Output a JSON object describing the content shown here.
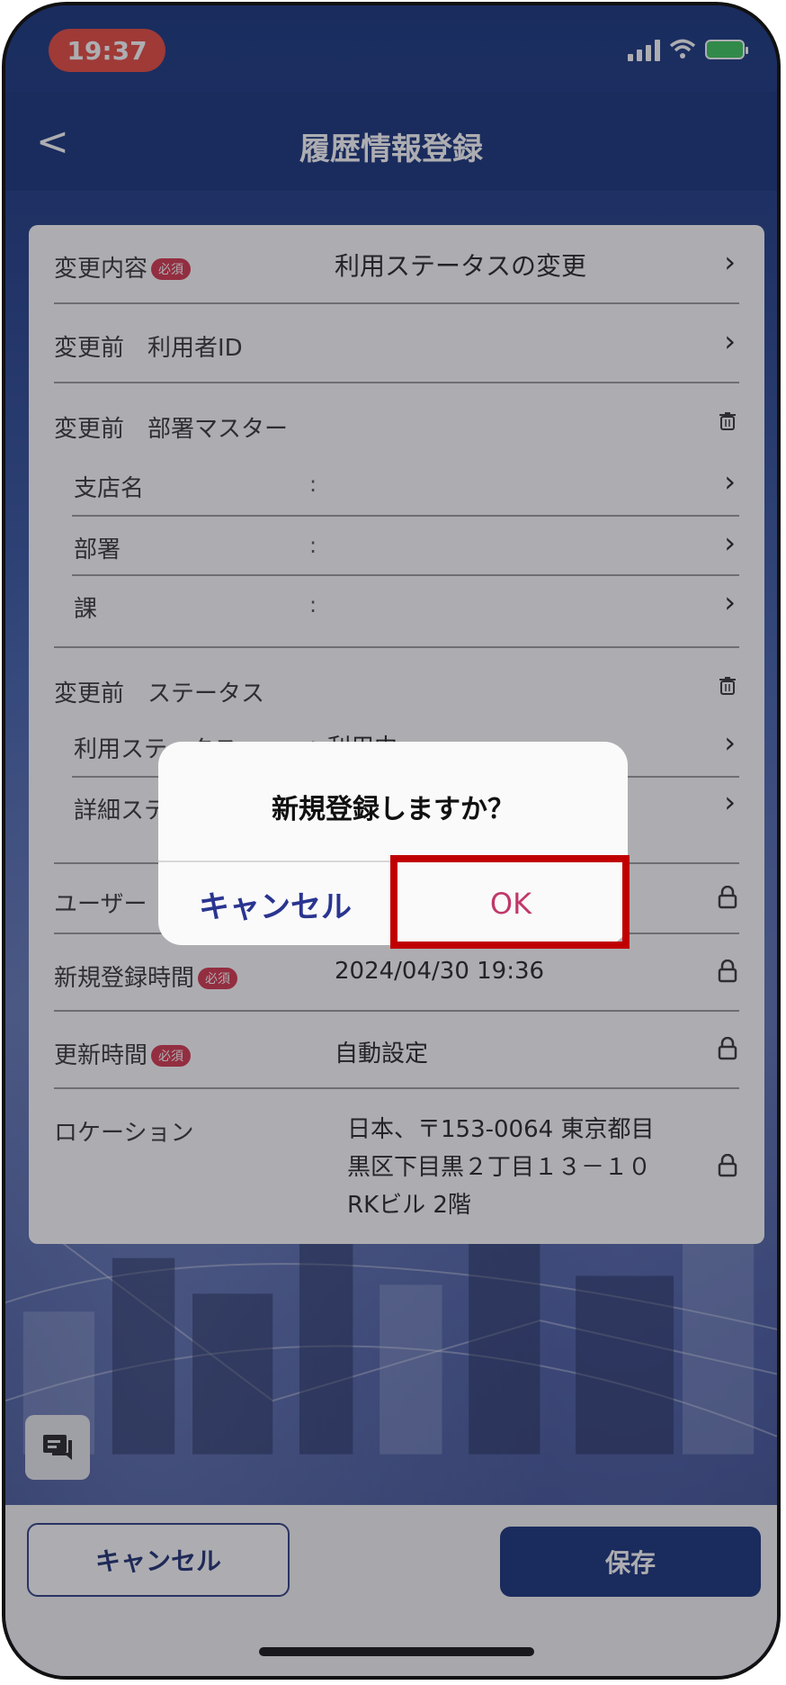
{
  "status": {
    "time": "19:37"
  },
  "nav": {
    "title": "履歴情報登録",
    "back_glyph": "<"
  },
  "form": {
    "required_badge": "必須",
    "change_content": {
      "label": "変更内容",
      "value": "利用ステータスの変更"
    },
    "before_user_id": {
      "label": "変更前　利用者ID"
    },
    "before_dept_master": {
      "label": "変更前　部署マスター",
      "branch": {
        "label": "支店名",
        "colon": ":"
      },
      "dept": {
        "label": "部署",
        "colon": ":"
      },
      "section": {
        "label": "課",
        "colon": ":"
      }
    },
    "before_status": {
      "label": "変更前　ステータス",
      "usage": {
        "label": "利用ステータス",
        "colon": ":",
        "value": "利用中"
      },
      "detail": {
        "label": "詳細ステータス"
      }
    },
    "user": {
      "label": "ユーザー"
    },
    "created_time": {
      "label": "新規登録時間",
      "value": "2024/04/30 19:36"
    },
    "updated_time": {
      "label": "更新時間",
      "value": "自動設定"
    },
    "location": {
      "label": "ロケーション",
      "line1": "日本、〒153-0064 東京都目",
      "line2": "黒区下目黒２丁目１３－１０",
      "line3": "RKビル 2階"
    }
  },
  "footer": {
    "cancel_label": "キャンセル",
    "save_label": "保存"
  },
  "dialog": {
    "message": "新規登録しますか？",
    "cancel_label": "キャンセル",
    "ok_label": "OK"
  },
  "colors": {
    "navbar": "#122e78",
    "required": "#d6334a",
    "highlight": "#c00000",
    "ok_text": "#c0386a"
  }
}
